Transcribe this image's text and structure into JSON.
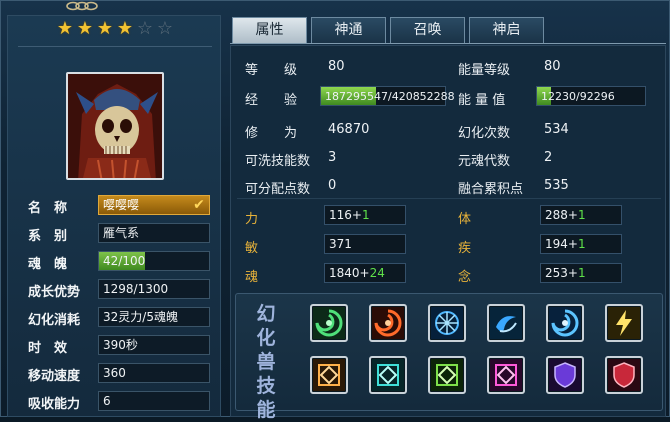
{
  "stars": {
    "filled": 4,
    "total": 6
  },
  "tabs": [
    {
      "label": "属性",
      "active": true
    },
    {
      "label": "神通",
      "active": false
    },
    {
      "label": "召唤",
      "active": false
    },
    {
      "label": "神启",
      "active": false
    }
  ],
  "pet_info": {
    "name_label": "名　称",
    "name_value": "嘤嘤嘤",
    "type_label": "系　别",
    "type_value": "雁气系",
    "soul_label": "魂　魄",
    "soul_value": "42/100",
    "soul_progress": 0.42,
    "growth_label": "成长优势",
    "growth_value": "1298/1300",
    "cost_label": "幻化消耗",
    "cost_value": "32灵力/5魂魄",
    "duration_label": "时　效",
    "duration_value": "390秒",
    "speed_label": "移动速度",
    "speed_value": "360",
    "absorb_label": "吸收能力",
    "absorb_value": "6"
  },
  "stats": {
    "level_label": "等　　级",
    "level_value": "80",
    "exp_label": "经　　验",
    "exp_value": "187295547/420852288",
    "exp_progress": 0.445,
    "cultivation_label": "修　　为",
    "cultivation_value": "46870",
    "washable_label": "可洗技能数",
    "washable_value": "3",
    "points_label": "可分配点数",
    "points_value": "0",
    "energy_level_label": "能量等级",
    "energy_level_value": "80",
    "energy_value_label": "能 量 值",
    "energy_value": "12230/92296",
    "energy_progress": 0.132,
    "transform_label": "幻化次数",
    "transform_value": "534",
    "soul_gen_label": "元魂代数",
    "soul_gen_value": "2",
    "fusion_label": "融合累积点",
    "fusion_value": "535"
  },
  "attributes": {
    "str_label": "力",
    "str_base": "116+",
    "str_bonus": "1",
    "agi_label": "敏",
    "agi_base": "371",
    "soul_label": "魂",
    "soul_base": "1840+",
    "soul_bonus": "24",
    "body_label": "体",
    "body_base": "288+",
    "body_bonus": "1",
    "haste_label": "疾",
    "haste_base": "194+",
    "haste_bonus": "1",
    "mind_label": "念",
    "mind_base": "253+",
    "mind_bonus": "1"
  },
  "skills": {
    "title": [
      "幻",
      "化",
      "兽",
      "技",
      "能"
    ],
    "icons": [
      "green-swirl-icon",
      "fire-swirl-icon",
      "ice-orb-icon",
      "water-swirl-icon",
      "blue-swirl-icon",
      "lightning-icon",
      "gold-rune-icon",
      "cyan-rune-icon",
      "green-rune-icon",
      "pink-rune-icon",
      "purple-shield-icon",
      "red-shield-icon"
    ]
  },
  "colors": {
    "accent_gold": "#e7b23a",
    "bonus_green": "#5fe04a",
    "star_gold": "#f1c232"
  }
}
